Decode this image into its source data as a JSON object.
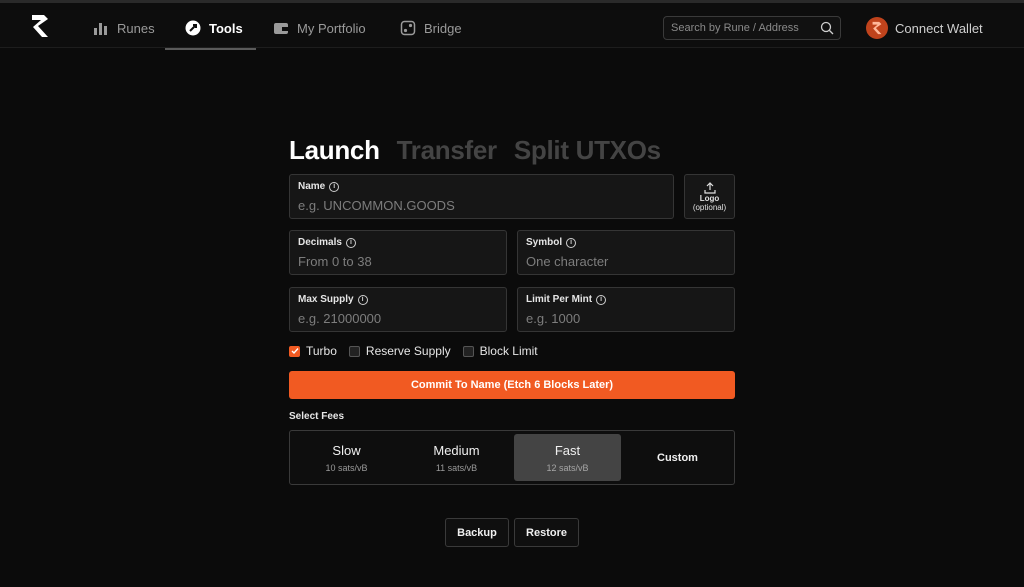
{
  "nav": {
    "items": [
      {
        "label": "Runes",
        "icon": "bar-chart-icon"
      },
      {
        "label": "Tools",
        "icon": "tools-icon"
      },
      {
        "label": "My Portfolio",
        "icon": "wallet-icon"
      },
      {
        "label": "Bridge",
        "icon": "bridge-icon"
      }
    ],
    "search_placeholder": "Search by Rune / Address",
    "connect_wallet": "Connect Wallet"
  },
  "tabs": [
    "Launch",
    "Transfer",
    "Split UTXOs"
  ],
  "form": {
    "name": {
      "label": "Name",
      "placeholder": "e.g. UNCOMMON.GOODS"
    },
    "logo": {
      "label": "Logo",
      "sub": "(optional)"
    },
    "decimals": {
      "label": "Decimals",
      "placeholder": "From 0 to 38"
    },
    "symbol": {
      "label": "Symbol",
      "placeholder": "One character"
    },
    "max_supply": {
      "label": "Max Supply",
      "placeholder": "e.g. 21000000"
    },
    "limit_per_mint": {
      "label": "Limit Per Mint",
      "placeholder": "e.g. 1000"
    }
  },
  "options": [
    {
      "label": "Turbo",
      "checked": true
    },
    {
      "label": "Reserve Supply",
      "checked": false
    },
    {
      "label": "Block Limit",
      "checked": false
    }
  ],
  "commit_label": "Commit To Name (Etch 6 Blocks Later)",
  "fees": {
    "title": "Select Fees",
    "items": [
      {
        "name": "Slow",
        "rate": "10 sats/vB"
      },
      {
        "name": "Medium",
        "rate": "11 sats/vB"
      },
      {
        "name": "Fast",
        "rate": "12 sats/vB"
      },
      {
        "name": "Custom",
        "rate": ""
      }
    ],
    "selected": "Fast"
  },
  "actions": {
    "backup": "Backup",
    "restore": "Restore"
  },
  "colors": {
    "accent": "#f15a22",
    "background": "#0b0b0b"
  }
}
